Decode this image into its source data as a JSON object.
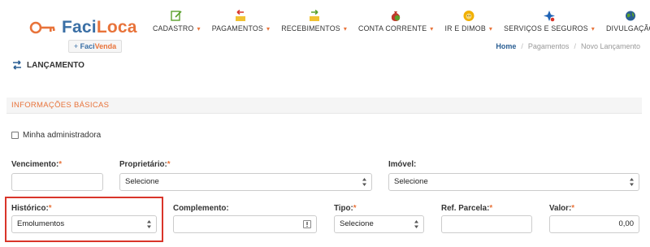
{
  "brand": {
    "name_primary": "Faci",
    "name_accent": "Loca",
    "subbrand_prefix": "+ ",
    "subbrand_part1": "Faci",
    "subbrand_part2": "Venda"
  },
  "nav": {
    "items": [
      {
        "label": "CADASTRO",
        "icon": "edit-icon",
        "color": "#5aa02c"
      },
      {
        "label": "PAGAMENTOS",
        "icon": "payments-icon",
        "color": "#d9352a"
      },
      {
        "label": "RECEBIMENTOS",
        "icon": "receipts-icon",
        "color": "#5aa02c"
      },
      {
        "label": "CONTA CORRENTE",
        "icon": "money-bag-icon",
        "color": "#c0392b"
      },
      {
        "label": "IR E DIMOB",
        "icon": "lion-icon",
        "color": "#e8a100"
      },
      {
        "label": "SERVIÇOS E SEGUROS",
        "icon": "services-icon",
        "color": "#1f63b5"
      },
      {
        "label": "DIVULGAÇÃO",
        "icon": "globe-icon",
        "color": "#333333"
      }
    ],
    "caret": "▾"
  },
  "breadcrumb": {
    "home": "Home",
    "items": [
      "Pagamentos",
      "Novo Lançamento"
    ],
    "separator": "/"
  },
  "page": {
    "title": "LANÇAMENTO"
  },
  "section": {
    "title": "INFORMAÇÕES BÁSICAS"
  },
  "form": {
    "minha_administradora": {
      "label": "Minha administradora",
      "checked": false
    },
    "vencimento": {
      "label": "Vencimento:",
      "required": "*",
      "value": ""
    },
    "proprietario": {
      "label": "Proprietário:",
      "required": "*",
      "value": "Selecione"
    },
    "imovel": {
      "label": "Imóvel:",
      "value": "Selecione"
    },
    "historico": {
      "label": "Histórico:",
      "required": "*",
      "value": "Emolumentos"
    },
    "complemento": {
      "label": "Complemento:",
      "value": ""
    },
    "tipo": {
      "label": "Tipo:",
      "required": "*",
      "value": "Selecione"
    },
    "ref_parcela": {
      "label": "Ref. Parcela:",
      "required": "*",
      "value": ""
    },
    "valor": {
      "label": "Valor:",
      "required": "*",
      "value": "0,00"
    }
  },
  "colors": {
    "accent": "#e8733a",
    "brand_blue": "#3a6fa5",
    "highlight": "#d9352a"
  }
}
